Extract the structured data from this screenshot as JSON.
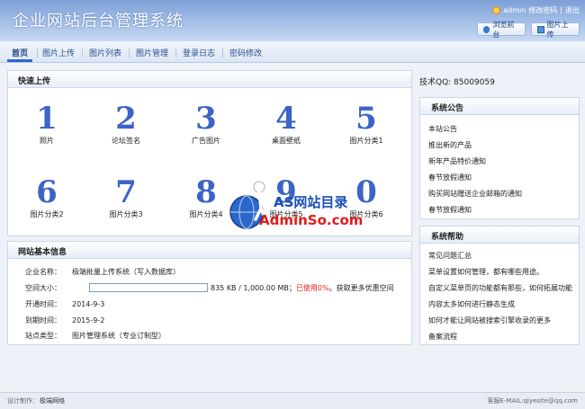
{
  "header": {
    "title": "企业网站后台管理系统",
    "user": "admin",
    "change_pwd": "修改密码",
    "separator": "|",
    "logout": "退出",
    "browse_front": "浏览前台",
    "upload_image": "图片上传"
  },
  "nav": {
    "items": [
      {
        "label": "首页"
      },
      {
        "label": "图片上传"
      },
      {
        "label": "图片列表"
      },
      {
        "label": "图片管理"
      },
      {
        "label": "登录日志"
      },
      {
        "label": "密码修改"
      }
    ]
  },
  "quick_upload": {
    "title": "快速上传",
    "categories": [
      {
        "num": "1",
        "label": "照片"
      },
      {
        "num": "2",
        "label": "论坛签名"
      },
      {
        "num": "3",
        "label": "广告图片"
      },
      {
        "num": "4",
        "label": "桌面壁纸"
      },
      {
        "num": "5",
        "label": "图片分类1"
      },
      {
        "num": "6",
        "label": "图片分类2"
      },
      {
        "num": "7",
        "label": "图片分类3"
      },
      {
        "num": "8",
        "label": "图片分类4"
      },
      {
        "num": "9",
        "label": "图片分类5"
      },
      {
        "num": "0",
        "label": "图片分类6"
      }
    ]
  },
  "site_info": {
    "title": "网站基本信息",
    "company_label": "企业名称：",
    "company_value": "极端批量上传系统（写入数据库）",
    "space_label": "空间大小：",
    "space_used_fraction": 0,
    "space_value": "835 KB / 1,000.00 MB；",
    "space_used": "已使用0%",
    "space_more": "。获取更多优惠空间",
    "open_label": "开通时间：",
    "open_value": "2014-9-3",
    "expire_label": "到期时间：",
    "expire_value": "2015-9-2",
    "type_label": "站点类型：",
    "type_value": "图片管理系统（专业订制型）"
  },
  "right": {
    "qq": "技术QQ:  85009059",
    "notice_title": "系统公告",
    "notices": [
      "本站公告",
      "推出新的产品",
      "新年产品特价通知",
      "春节放假通知",
      "购买网站赠送企业邮箱的通知",
      "春节放假通知"
    ],
    "help_title": "系统帮助",
    "helps": [
      "常见问题汇总",
      "菜单设置如何管理，都有哪些用途。",
      "自定义菜单页的功能都有那些，如何拓展功能",
      "内容太多如何进行静态生成",
      "如何才能让网站被搜索引擎收录的更多",
      "备案流程"
    ]
  },
  "watermark": {
    "line1": "AS网站目录",
    "line2": "AdminSo.com"
  },
  "footer": {
    "design_label": "设计制作：",
    "design_value": "极端网络",
    "contact": "客服E-MAIL:qiyesite@qq.com"
  },
  "colors": {
    "accent": "#3b64c4",
    "header_top": "#7d9fd6",
    "used_red": "#e02020"
  }
}
